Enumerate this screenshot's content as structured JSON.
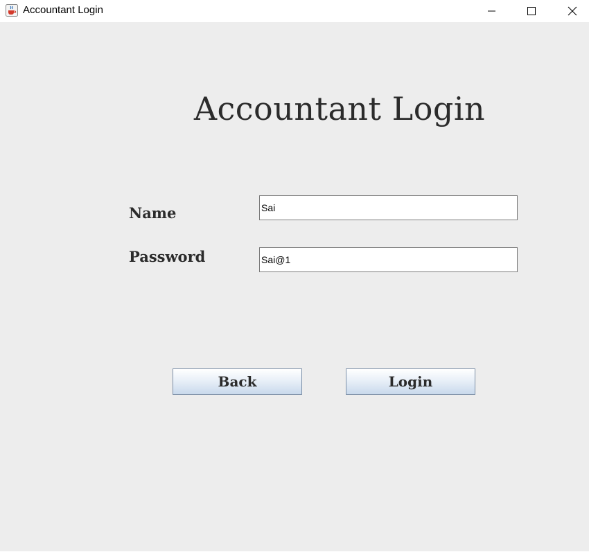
{
  "window": {
    "title": "Accountant Login",
    "icon": "java-coffee-cup-icon",
    "controls": [
      "minimize-icon",
      "maximize-icon",
      "close-icon"
    ]
  },
  "form": {
    "heading": "Accountant Login",
    "name_label": "Name",
    "name_value": "Sai",
    "password_label": "Password",
    "password_value": "Sai@1"
  },
  "buttons": {
    "back_label": "Back",
    "login_label": "Login"
  },
  "colors": {
    "background": "#ededed",
    "titlebar": "#ffffff",
    "text": "#2b2b2b",
    "button_top": "#ffffff",
    "button_bottom": "#c9d9ec",
    "button_border": "#7a8ea6"
  }
}
